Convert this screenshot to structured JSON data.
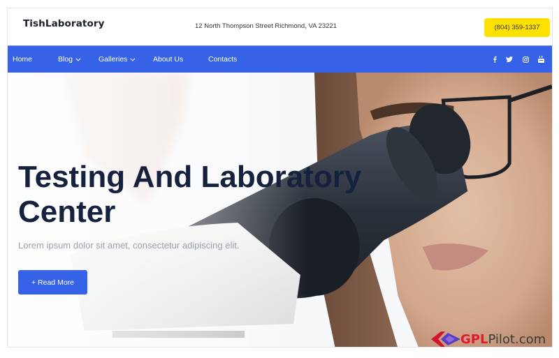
{
  "header": {
    "logo": "TishLaboratory",
    "address": "12 North Thompson Street Richmond, VA 23221",
    "phone": "(804) 359-1337"
  },
  "nav": {
    "items": [
      {
        "label": "Home",
        "has_dropdown": false
      },
      {
        "label": "Blog",
        "has_dropdown": true
      },
      {
        "label": "Galleries",
        "has_dropdown": true
      },
      {
        "label": "About Us",
        "has_dropdown": false
      },
      {
        "label": "Contacts",
        "has_dropdown": false
      }
    ],
    "social": [
      "facebook-icon",
      "twitter-icon",
      "instagram-icon",
      "youtube-icon"
    ]
  },
  "hero": {
    "title_line1": "Testing And Laboratory",
    "title_line2": "Center",
    "subtitle": "Lorem ipsum dolor sit amet, consectetur adipiscing elit.",
    "button_label": "+ Read More"
  },
  "watermark": {
    "part1": "GPL",
    "part2": "Pilot.com"
  },
  "colors": {
    "primary": "#3662e8",
    "phone_button": "#ffe100",
    "title": "#16213e",
    "watermark_red": "#e0192d"
  }
}
